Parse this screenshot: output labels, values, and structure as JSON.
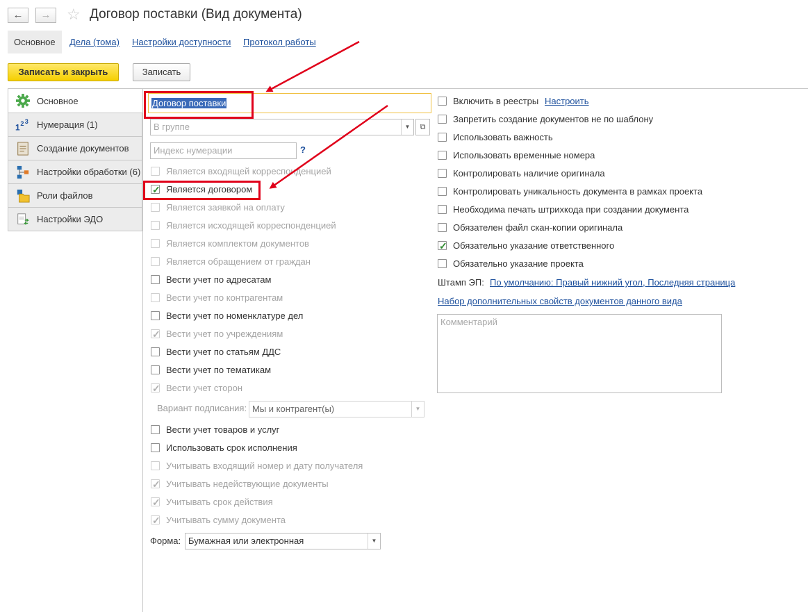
{
  "header": {
    "title": "Договор поставки (Вид документа)",
    "back_icon": "arrow-left",
    "forward_icon": "arrow-right",
    "favorite_icon": "star"
  },
  "top_tabs": [
    {
      "label": "Основное",
      "active": true
    },
    {
      "label": "Дела (тома)"
    },
    {
      "label": "Настройки доступности"
    },
    {
      "label": "Протокол работы"
    }
  ],
  "toolbar": {
    "save_close_label": "Записать и закрыть",
    "save_label": "Записать"
  },
  "side_nav": [
    {
      "label": "Основное",
      "icon": "gear-icon"
    },
    {
      "label": "Нумерация (1)",
      "icon": "numbering-icon"
    },
    {
      "label": "Создание документов",
      "icon": "document-icon"
    },
    {
      "label": "Настройки обработки (6)",
      "icon": "workflow-icon"
    },
    {
      "label": "Роли файлов",
      "icon": "folder-icon"
    },
    {
      "label": "Настройки ЭДО",
      "icon": "edo-icon"
    }
  ],
  "form": {
    "name_value": "Договор поставки",
    "group_placeholder": "В группе",
    "index_placeholder": "Индекс нумерации",
    "help_mark": "?",
    "left_checkboxes": [
      {
        "label": "Является входящей корреспонденцией",
        "checked": false,
        "disabled": true
      },
      {
        "label": "Является договором",
        "checked": true,
        "disabled": false
      },
      {
        "label": "Является заявкой на оплату",
        "checked": false,
        "disabled": true
      },
      {
        "label": "Является исходящей корреспонденцией",
        "checked": false,
        "disabled": true
      },
      {
        "label": "Является комплектом документов",
        "checked": false,
        "disabled": true
      },
      {
        "label": "Является обращением от граждан",
        "checked": false,
        "disabled": true
      },
      {
        "label": "Вести учет по адресатам",
        "checked": false,
        "disabled": false
      },
      {
        "label": "Вести учет по контрагентам",
        "checked": false,
        "disabled": true
      },
      {
        "label": "Вести учет по номенклатуре дел",
        "checked": false,
        "disabled": false
      },
      {
        "label": "Вести учет по учреждениям",
        "checked": true,
        "disabled": true
      },
      {
        "label": "Вести учет по статьям ДДС",
        "checked": false,
        "disabled": false
      },
      {
        "label": "Вести учет по тематикам",
        "checked": false,
        "disabled": false
      },
      {
        "label": "Вести учет сторон",
        "checked": true,
        "disabled": true
      }
    ],
    "sign_variant_label": "Вариант подписания:",
    "sign_variant_value": "Мы и контрагент(ы)",
    "left_checkboxes_2": [
      {
        "label": "Вести учет товаров и услуг",
        "checked": false,
        "disabled": false
      },
      {
        "label": "Использовать срок исполнения",
        "checked": false,
        "disabled": false
      },
      {
        "label": "Учитывать входящий номер и дату получателя",
        "checked": false,
        "disabled": true
      },
      {
        "label": "Учитывать недействующие документы",
        "checked": true,
        "disabled": true
      },
      {
        "label": "Учитывать срок действия",
        "checked": true,
        "disabled": true
      },
      {
        "label": "Учитывать сумму документа",
        "checked": true,
        "disabled": true
      }
    ],
    "form_label": "Форма:",
    "form_value": "Бумажная или электронная",
    "right_checkboxes": [
      {
        "label": "Включить в реестры",
        "checked": false,
        "disabled": false
      },
      {
        "label": "Запретить создание документов не по шаблону",
        "checked": false,
        "disabled": false
      },
      {
        "label": "Использовать важность",
        "checked": false,
        "disabled": false
      },
      {
        "label": "Использовать временные номера",
        "checked": false,
        "disabled": false
      },
      {
        "label": "Контролировать наличие оригинала",
        "checked": false,
        "disabled": false
      },
      {
        "label": "Контролировать уникальность документа в рамках проекта",
        "checked": false,
        "disabled": false
      },
      {
        "label": "Необходима печать штрихкода при создании документа",
        "checked": false,
        "disabled": false
      },
      {
        "label": "Обязателен файл скан-копии оригинала",
        "checked": false,
        "disabled": false
      },
      {
        "label": "Обязательно указание ответственного",
        "checked": true,
        "disabled": false
      },
      {
        "label": "Обязательно указание проекта",
        "checked": false,
        "disabled": false
      }
    ],
    "configure_link": "Настроить",
    "stamp_label": "Штамп ЭП:",
    "stamp_link": "По умолчанию: Правый нижний угол, Последняя страница",
    "extra_props_link": "Набор дополнительных свойств документов данного вида",
    "comment_placeholder": "Комментарий"
  },
  "colors": {
    "accent_yellow": "#f5d000",
    "link": "#1c4f9c",
    "annotation_red": "#e0001a",
    "check_green": "#2d8a2d"
  }
}
